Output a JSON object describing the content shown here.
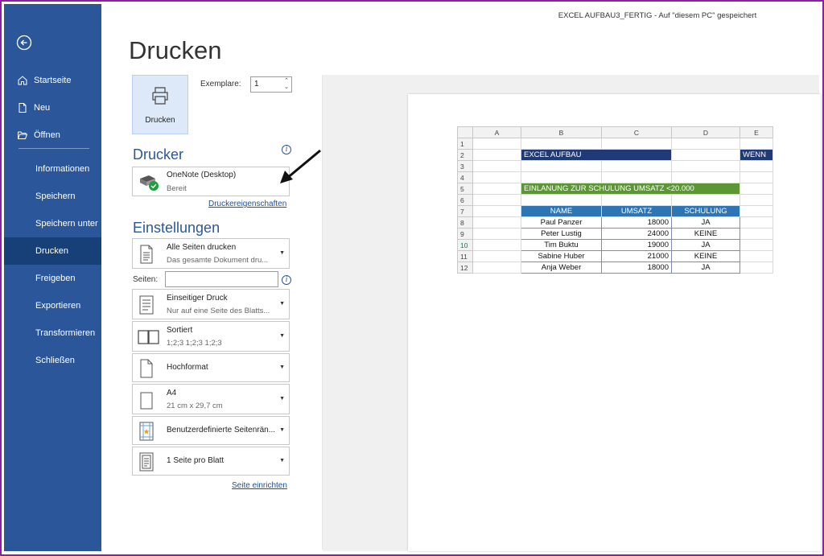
{
  "window": {
    "title": "EXCEL AUFBAU3_FERTIG  -  Auf \"diesem PC\" gespeichert"
  },
  "sidebar": {
    "top_items": [
      {
        "label": "Startseite",
        "icon": "home-icon"
      },
      {
        "label": "Neu",
        "icon": "new-document-icon"
      },
      {
        "label": "Öffnen",
        "icon": "folder-open-icon"
      }
    ],
    "items": [
      {
        "label": "Informationen"
      },
      {
        "label": "Speichern"
      },
      {
        "label": "Speichern unter"
      },
      {
        "label": "Drucken",
        "active": true
      },
      {
        "label": "Freigeben"
      },
      {
        "label": "Exportieren"
      },
      {
        "label": "Transformieren"
      },
      {
        "label": "Schließen"
      }
    ]
  },
  "print": {
    "title": "Drucken",
    "button_label": "Drucken",
    "copies_label": "Exemplare:",
    "copies_value": "1",
    "printer_heading": "Drucker",
    "printer_name": "OneNote (Desktop)",
    "printer_status": "Bereit",
    "printer_properties_link": "Druckereigenschaften",
    "settings_heading": "Einstellungen",
    "settings": [
      {
        "line1": "Alle Seiten drucken",
        "line2": "Das gesamte Dokument dru...",
        "icon": "document-pages-icon"
      },
      {
        "line1": "Einseitiger Druck",
        "line2": "Nur auf eine Seite des Blatts...",
        "icon": "single-sided-icon"
      },
      {
        "line1": "Sortiert",
        "line2": "1;2;3   1;2;3   1;2;3",
        "icon": "collated-icon"
      },
      {
        "line1": "Hochformat",
        "line2": "",
        "icon": "portrait-icon"
      },
      {
        "line1": "A4",
        "line2": "21 cm x 29,7 cm",
        "icon": "paper-size-icon"
      },
      {
        "line1": "Benutzerdefinierte Seitenrän...",
        "line2": "",
        "icon": "margins-icon"
      },
      {
        "line1": "1 Seite pro Blatt",
        "line2": "",
        "icon": "pages-per-sheet-icon"
      }
    ],
    "pages_label": "Seiten:",
    "pages_value": "",
    "page_setup_link": "Seite einrichten"
  },
  "preview": {
    "columns": [
      "A",
      "B",
      "C",
      "D",
      "E"
    ],
    "rows": [
      "1",
      "2",
      "3",
      "4",
      "5",
      "6",
      "7",
      "8",
      "9",
      "10",
      "11",
      "12"
    ],
    "banner1": "EXCEL AUFBAU",
    "wenn": "WENN",
    "banner2": "EINLANUNG ZUR SCHULUNG UMSATZ <20.000",
    "table_headers": [
      "NAME",
      "UMSATZ",
      "SCHULUNG"
    ],
    "table_rows": [
      {
        "name": "Paul Panzer",
        "umsatz": "18000",
        "schulung": "JA"
      },
      {
        "name": "Peter Lustig",
        "umsatz": "24000",
        "schulung": "KEINE"
      },
      {
        "name": "Tim Buktu",
        "umsatz": "19000",
        "schulung": "JA"
      },
      {
        "name": "Sabine Huber",
        "umsatz": "21000",
        "schulung": "KEINE"
      },
      {
        "name": "Anja Weber",
        "umsatz": "18000",
        "schulung": "JA"
      }
    ]
  },
  "colors": {
    "sidebar": "#2b579a",
    "active": "#173f78",
    "accent": "#2b579a",
    "frame": "#8b1fa8"
  }
}
